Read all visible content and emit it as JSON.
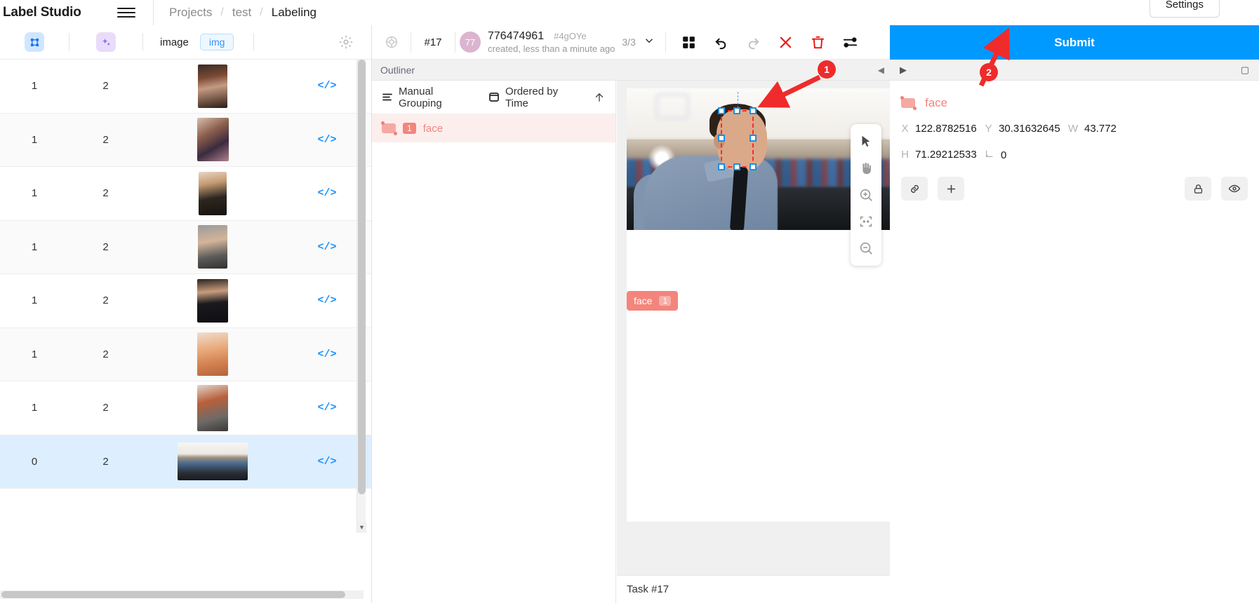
{
  "app": {
    "brand": "Label Studio",
    "menu_icon": "hamburger-icon"
  },
  "breadcrumb": {
    "items": [
      "Projects",
      "test",
      "Labeling"
    ],
    "separator": "/"
  },
  "header": {
    "settings_label": "Settings"
  },
  "data_table": {
    "columns": {
      "col1_icon": "grid-select-icon",
      "col2_icon": "sparkles-icon",
      "col3_label": "image",
      "col3_tag": "img",
      "settings_icon": "gear-icon"
    },
    "rows": [
      {
        "c1": "1",
        "c2": "2",
        "code": "</>",
        "selected": false
      },
      {
        "c1": "1",
        "c2": "2",
        "code": "</>",
        "selected": false
      },
      {
        "c1": "1",
        "c2": "2",
        "code": "</>",
        "selected": false
      },
      {
        "c1": "1",
        "c2": "2",
        "code": "</>",
        "selected": false
      },
      {
        "c1": "1",
        "c2": "2",
        "code": "</>",
        "selected": false
      },
      {
        "c1": "1",
        "c2": "2",
        "code": "</>",
        "selected": false
      },
      {
        "c1": "1",
        "c2": "2",
        "code": "</>",
        "selected": false
      },
      {
        "c1": "0",
        "c2": "2",
        "code": "</>",
        "selected": true
      }
    ]
  },
  "task_header": {
    "gear_icon": "settings-gear-icon",
    "task_id": "#17",
    "avatar_initials": "77",
    "annotation_id": "776474961",
    "annotation_hash": "#4gOYe",
    "created_text": "created, less than a minute ago",
    "annotation_count": "3/3",
    "chevron": "chevron-down-icon",
    "tools": [
      {
        "name": "grid-view-icon",
        "glyph": "grid"
      },
      {
        "name": "undo-icon",
        "glyph": "undo"
      },
      {
        "name": "redo-icon",
        "glyph": "redo"
      },
      {
        "name": "reset-icon",
        "glyph": "x"
      },
      {
        "name": "delete-icon",
        "glyph": "trash"
      },
      {
        "name": "settings-sliders-icon",
        "glyph": "sliders"
      }
    ]
  },
  "outliner": {
    "title": "Outliner",
    "collapse_icon": "collapse-left-icon",
    "grouping_label": "Manual Grouping",
    "grouping_icon": "list-lines-icon",
    "ordering_label": "Ordered by Time",
    "ordering_icon": "square-box-icon",
    "sort_icon": "arrow-up-icon",
    "regions": [
      {
        "badge": "1",
        "label": "face",
        "swatch_color": "#f5a9a2"
      }
    ]
  },
  "canvas": {
    "label_chip": {
      "label": "face",
      "number": "1"
    },
    "zoom_tools": [
      {
        "name": "cursor-tool-icon"
      },
      {
        "name": "hand-pan-tool-icon"
      },
      {
        "name": "zoom-in-icon"
      },
      {
        "name": "fit-to-screen-icon"
      },
      {
        "name": "zoom-out-icon"
      }
    ],
    "footer_label": "Task #17"
  },
  "details_panel": {
    "expand_icon": "triangle-right-icon",
    "corner_icon": "detail-icon",
    "region_label": "face",
    "coords": [
      {
        "key": "X",
        "value": "122.8782516"
      },
      {
        "key": "Y",
        "value": "30.31632645"
      },
      {
        "key": "W",
        "value": "43.772"
      },
      {
        "key": "H",
        "value": "71.29212533"
      },
      {
        "key": "angle",
        "value": "0"
      }
    ],
    "actions": [
      {
        "name": "relation-link-button",
        "glyph": "link"
      },
      {
        "name": "add-meta-button",
        "glyph": "plus"
      },
      {
        "name": "lock-region-button",
        "glyph": "lock"
      },
      {
        "name": "hide-region-button",
        "glyph": "eye"
      }
    ],
    "submit_label": "Submit"
  },
  "callouts": [
    {
      "number": "1",
      "target": "bounding-box"
    },
    {
      "number": "2",
      "target": "submit-button"
    }
  ],
  "colors": {
    "accent_blue": "#0099ff",
    "region_red": "#f3857c",
    "callout_red": "#ef2b2b",
    "selected_row": "#ddeeff"
  }
}
